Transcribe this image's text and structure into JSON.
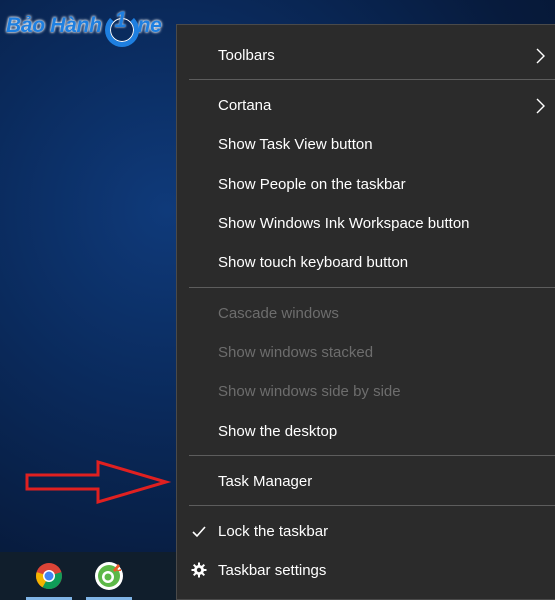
{
  "watermark": {
    "brand_left": "Bảo Hành",
    "brand_one": "1",
    "brand_right": "ne"
  },
  "context_menu": {
    "toolbars": "Toolbars",
    "cortana": "Cortana",
    "show_task_view": "Show Task View button",
    "show_people": "Show People on the taskbar",
    "show_ink_workspace": "Show Windows Ink Workspace button",
    "show_touch_keyboard": "Show touch keyboard button",
    "cascade_windows": "Cascade windows",
    "show_windows_stacked": "Show windows stacked",
    "show_windows_side_by_side": "Show windows side by side",
    "show_desktop": "Show the desktop",
    "task_manager": "Task Manager",
    "lock_taskbar": "Lock the taskbar",
    "taskbar_settings": "Taskbar settings"
  },
  "icons": {
    "submenu": "chevron-right-icon",
    "checked": "checkmark-icon",
    "settings": "gear-icon",
    "annotation": "red-arrow-icon"
  },
  "taskbar": {
    "pinned": [
      "chrome-icon",
      "coccoc-icon"
    ]
  },
  "colors": {
    "menu_bg": "#2b2b2b",
    "menu_text": "#ffffff",
    "disabled_text": "#6d6d6d",
    "separator": "#5d5d5d",
    "annotation": "#e02020",
    "brand": "#1e7fe0"
  }
}
